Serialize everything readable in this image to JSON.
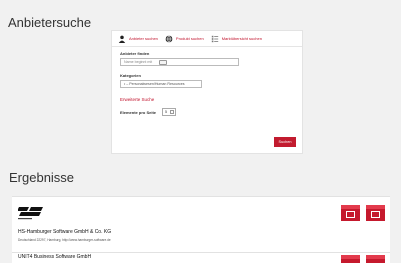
{
  "page": {
    "title": "Anbietersuche",
    "results_title": "Ergebnisse"
  },
  "tabs": [
    {
      "label": "Anbieter suchen",
      "icon": "person-icon"
    },
    {
      "label": "Produkt suchen",
      "icon": "globe-icon"
    },
    {
      "label": "Marktübersicht suchen",
      "icon": "list-icon"
    }
  ],
  "form": {
    "provider_label": "Anbieter finden",
    "provider_placeholder": "Name beginnt mit",
    "category_label": "Kategorien",
    "category_value": "• – Personalwesen/Human Resources",
    "advanced_link": "Erweiterte Suche",
    "per_page_label": "Elemente pro Seite",
    "per_page_value": "5",
    "submit_label": "Suchen"
  },
  "results": [
    {
      "company": "HS-Hamburger Software GmbH & Co. KG",
      "address": "Deutschland 22297, Hamburg, http://www.hamburger-software.de"
    },
    {
      "company": "UNIT4 Business Software GmbH"
    }
  ],
  "colors": {
    "accent": "#c21b2f",
    "background": "#f1f1f1",
    "panel": "#ffffff"
  }
}
